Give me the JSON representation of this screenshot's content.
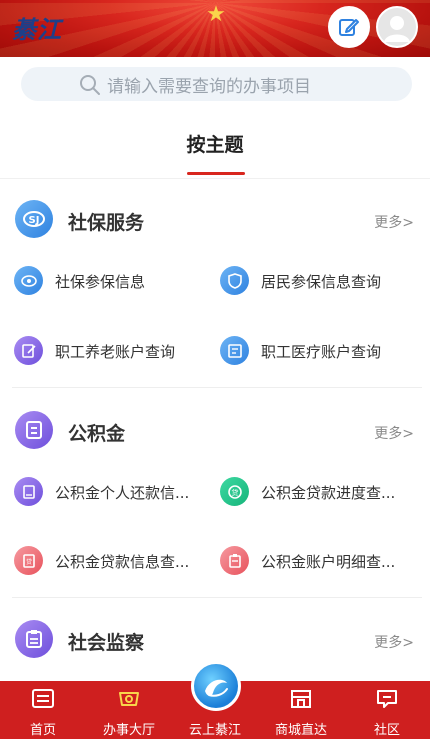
{
  "header": {
    "brand": "綦江",
    "emblem": "★"
  },
  "search": {
    "placeholder": "请输入需要查询的办事项目"
  },
  "tab": {
    "label": "按主题"
  },
  "sections": [
    {
      "title": "社保服务",
      "more": "更多>",
      "items": [
        {
          "label": "社保参保信息",
          "icon": "social-insurance-icon",
          "color": "blue"
        },
        {
          "label": "居民参保信息查询",
          "icon": "shield-icon",
          "color": "blue"
        },
        {
          "label": "职工养老账户查询",
          "icon": "document-edit-icon",
          "color": "purple"
        },
        {
          "label": "职工医疗账户查询",
          "icon": "medical-card-icon",
          "color": "blue"
        }
      ]
    },
    {
      "title": "公积金",
      "more": "更多>",
      "items": [
        {
          "label": "公积金个人还款信...",
          "icon": "document-icon",
          "color": "purple"
        },
        {
          "label": "公积金贷款进度查...",
          "icon": "loan-icon",
          "color": "green"
        },
        {
          "label": "公积金贷款信息查...",
          "icon": "loan-document-icon",
          "color": "pink"
        },
        {
          "label": "公积金账户明细查...",
          "icon": "clipboard-icon",
          "color": "pink"
        }
      ]
    },
    {
      "title": "社会监察",
      "more": "更多>"
    }
  ],
  "bottom_nav": {
    "items": [
      {
        "label": "首页",
        "icon": "home-icon"
      },
      {
        "label": "办事大厅",
        "icon": "service-hall-icon"
      },
      {
        "label": "云上綦江",
        "icon": "cloud-qijiang-logo-icon"
      },
      {
        "label": "商城直达",
        "icon": "store-icon"
      },
      {
        "label": "社区",
        "icon": "community-chat-icon"
      }
    ]
  },
  "colors": {
    "brand_red": "#cf1f1f",
    "accent_blue": "#2f82e0",
    "accent_purple": "#6e4fdc",
    "accent_green": "#16b47a",
    "accent_pink": "#e8525c"
  }
}
